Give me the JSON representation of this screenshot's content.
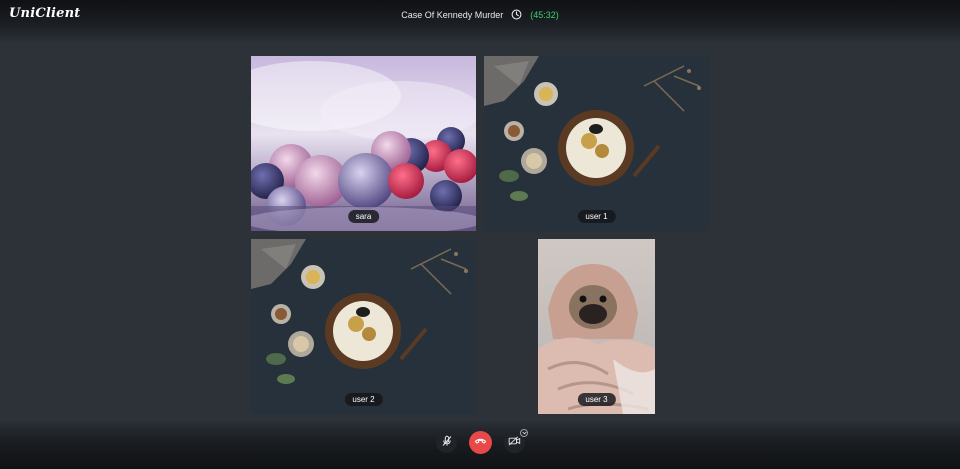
{
  "app": {
    "brand": "UniClient"
  },
  "call": {
    "title": "Case Of Kennedy Murder",
    "elapsed": "(45:32)"
  },
  "participants": [
    {
      "name": "sara",
      "video": "frozen-berries"
    },
    {
      "name": "user 1",
      "video": "food-flatlay"
    },
    {
      "name": "user 2",
      "video": "food-flatlay"
    },
    {
      "name": "user 3",
      "video": "pug-in-blanket"
    }
  ],
  "controls": {
    "mic": {
      "icon": "mic-off-icon"
    },
    "hangup": {
      "icon": "phone-hangup-icon",
      "color": "#e84848"
    },
    "camera": {
      "icon": "video-off-icon"
    }
  },
  "colors": {
    "timer": "#3ed16b",
    "background": "#2d3239"
  }
}
